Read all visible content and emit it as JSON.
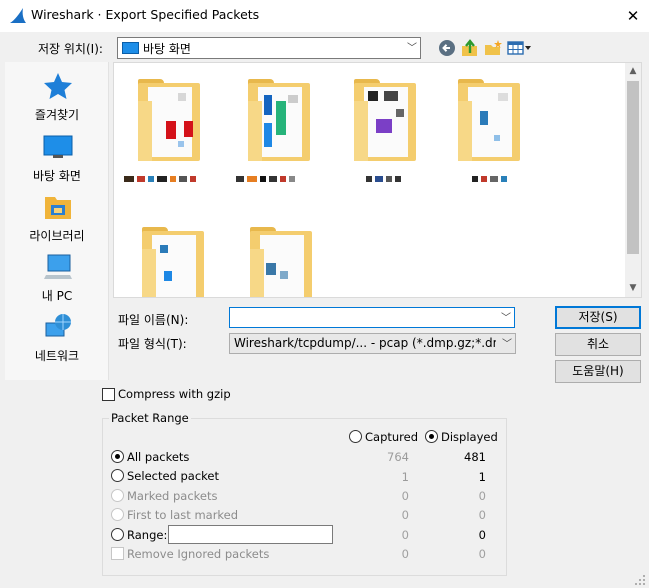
{
  "window": {
    "title": "Wireshark · Export Specified Packets",
    "close_glyph": "✕"
  },
  "location": {
    "label": "저장 위치(I):",
    "value": "바탕 화면",
    "toolbar_icons": [
      "back-icon",
      "up-folder-icon",
      "new-folder-icon",
      "view-menu-icon"
    ]
  },
  "places": [
    {
      "label": "즐겨찾기",
      "icon": "star-icon"
    },
    {
      "label": "바탕 화면",
      "icon": "desktop-icon"
    },
    {
      "label": "라이브러리",
      "icon": "library-icon"
    },
    {
      "label": "내 PC",
      "icon": "computer-icon"
    },
    {
      "label": "네트워크",
      "icon": "network-icon"
    }
  ],
  "file_name": {
    "label": "파일 이름(N):",
    "value": ""
  },
  "file_type": {
    "label": "파일 형식(T):",
    "value": "Wireshark/tcpdump/... - pcap (*.dmp.gz;*.dm"
  },
  "buttons": {
    "save": "저장(S)",
    "cancel": "취소",
    "help": "도움말(H)"
  },
  "compress": {
    "label": "Compress with gzip",
    "checked": false
  },
  "packet_range": {
    "title": "Packet Range",
    "captured_label": "Captured",
    "displayed_label": "Displayed",
    "displayed_selected": true,
    "rows": [
      {
        "label": "All packets",
        "captured": "764",
        "displayed": "481",
        "enabled": true,
        "selected": true
      },
      {
        "label": "Selected packet",
        "captured": "1",
        "displayed": "1",
        "enabled": true,
        "selected": false
      },
      {
        "label": "Marked packets",
        "captured": "0",
        "displayed": "0",
        "enabled": false,
        "selected": false
      },
      {
        "label": "First to last marked",
        "captured": "0",
        "displayed": "0",
        "enabled": false,
        "selected": false
      },
      {
        "label": "Range:",
        "captured": "0",
        "displayed": "0",
        "enabled": true,
        "selected": false
      },
      {
        "label": "Remove Ignored packets",
        "captured": "0",
        "displayed": "0",
        "enabled": false,
        "selected": false
      }
    ]
  },
  "colors": {
    "accent": "#0078d7",
    "folder": "#f4cd6e"
  }
}
